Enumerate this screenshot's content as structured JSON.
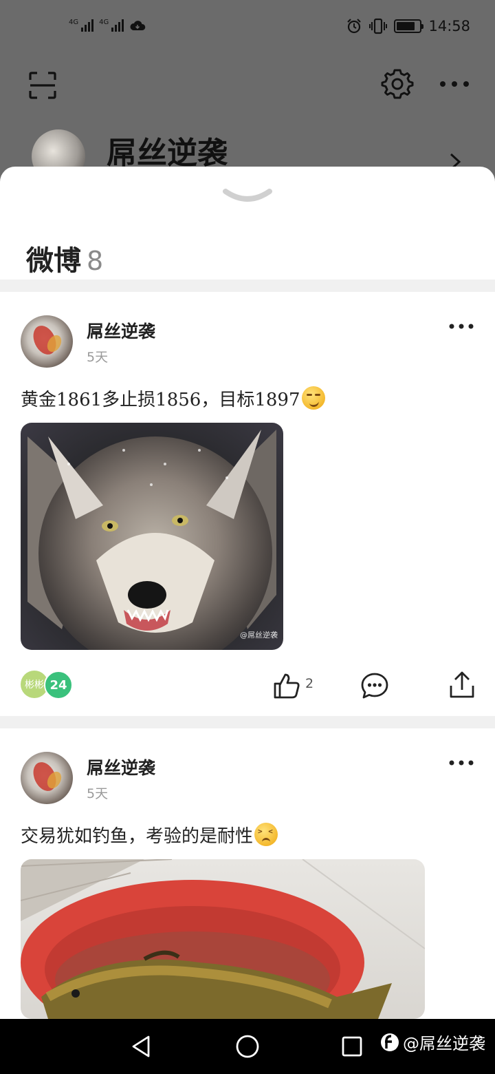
{
  "status_bar": {
    "network_1": "4G",
    "network_2": "4G",
    "time": "14:58",
    "icons": [
      "signal-icon",
      "signal-icon",
      "cloud-icon",
      "alarm-icon",
      "vibrate-icon",
      "battery-icon"
    ]
  },
  "top_bar": {
    "icons": [
      "scan-icon",
      "gear-icon",
      "more-icon"
    ]
  },
  "profile": {
    "name": "屌丝逆袭"
  },
  "sheet": {
    "title": "微博",
    "count": "8"
  },
  "posts": [
    {
      "author": "屌丝逆袭",
      "time": "5天",
      "text": "黄金1861多止损1856，目标1897",
      "emoji": "smirk-emoji",
      "image_watermark": "@屌丝逆袭",
      "badge_label": "彬彬",
      "badge_count": "24",
      "like_count": "2"
    },
    {
      "author": "屌丝逆袭",
      "time": "5天",
      "text": "交易犹如钓鱼，考验的是耐性",
      "emoji": "persevere-emoji"
    }
  ],
  "nav_bar": {
    "watermark": "@屌丝逆袭"
  }
}
